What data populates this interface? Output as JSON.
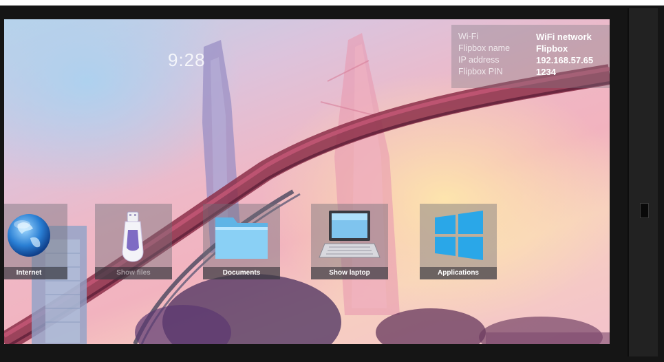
{
  "clock": {
    "time": "9:28"
  },
  "info": [
    {
      "key": "Wi-Fi",
      "value": "WiFi network"
    },
    {
      "key": "Flipbox name",
      "value": "Flipbox"
    },
    {
      "key": "IP address",
      "value": "192.168.57.65"
    },
    {
      "key": "Flipbox PIN",
      "value": "1234"
    }
  ],
  "tiles": [
    {
      "label": "Internet",
      "icon": "globe-icon"
    },
    {
      "label": "Show files",
      "icon": "usb-stick-icon"
    },
    {
      "label": "Documents",
      "icon": "folder-icon"
    },
    {
      "label": "Show laptop",
      "icon": "laptop-icon"
    },
    {
      "label": "Applications",
      "icon": "windows-icon"
    }
  ]
}
